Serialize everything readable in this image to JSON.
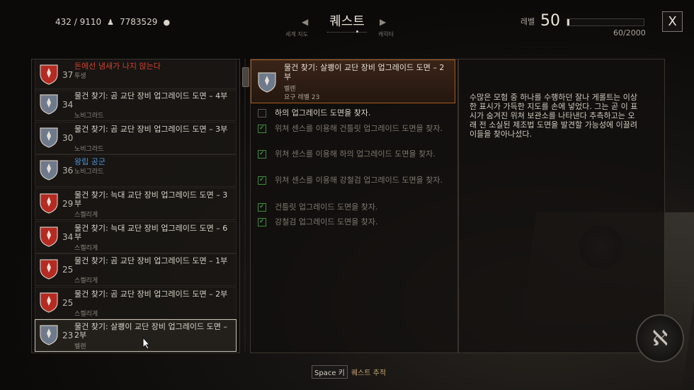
{
  "top": {
    "inventory": "432 / 9110",
    "gold": "7783529",
    "nav_title": "퀘스트",
    "nav_prev": "세계 지도",
    "nav_next": "캐릭터",
    "level_label": "레벨",
    "level_value": "50",
    "xp_text": "60/2000",
    "xp_fraction": 0.03,
    "close_label": "X"
  },
  "quests": [
    {
      "level": "37",
      "name": "돈에선 냄새가 나지 않는다",
      "giver": "투생",
      "shield": "red",
      "name_color": "red"
    },
    {
      "level": "34",
      "name": "물건 찾기: 곰 교단 장비 업그레이드 도면 – 4부",
      "giver": "노비그라드",
      "shield": "blue",
      "name_color": "normal"
    },
    {
      "level": "30",
      "name": "물건 찾기: 곰 교단 장비 업그레이드 도면 – 3부",
      "giver": "노비그라드",
      "shield": "blue",
      "name_color": "normal"
    },
    {
      "level": "36",
      "name": "왕립 공군",
      "giver": "노비그라드",
      "shield": "blue",
      "name_color": "blue"
    },
    {
      "level": "29",
      "name": "물건 찾기: 늑대 교단 장비 업그레이드 도면 – 3부",
      "giver": "스켈리게",
      "shield": "red",
      "name_color": "normal"
    },
    {
      "level": "34",
      "name": "물건 찾기: 늑대 교단 장비 업그레이드 도면 – 6부",
      "giver": "스켈리게",
      "shield": "red",
      "name_color": "normal"
    },
    {
      "level": "25",
      "name": "물건 찾기: 곰 교단 장비 업그레이드 도면 – 1부",
      "giver": "스켈리게",
      "shield": "red",
      "name_color": "normal"
    },
    {
      "level": "25",
      "name": "물건 찾기: 곰 교단 장비 업그레이드 도면 – 2부",
      "giver": "스켈리게",
      "shield": "red",
      "name_color": "normal"
    },
    {
      "level": "23",
      "name": "물건 찾기: 살쾡이 교단 장비 업그레이드 도면 – 2부",
      "giver": "벨렌",
      "shield": "blue",
      "name_color": "normal"
    }
  ],
  "selected": {
    "title": "물건 찾기: 살쾡이 교단 장비 업그레이드 도면 – 2부",
    "giver": "벨렌",
    "requirement": "요구 레벨 23"
  },
  "objectives": [
    {
      "text": "하의 업그레이드 도면을 찾자.",
      "done": false
    },
    {
      "text": "위쳐 센스를 이용해 건틀릿 업그레이드 도면을 찾자.",
      "done": true
    },
    {
      "text": "위쳐 센스를 이용해 하의 업그레이드 도면을 찾자.",
      "done": true
    },
    {
      "text": "위쳐 센스를 이용해 강철검 업그레이드 도면을 찾자.",
      "done": true
    },
    {
      "text": "건틀릿 업그레이드 도면을 찾자.",
      "done": true
    },
    {
      "text": "강철검 업그레이드 도면을 찾자.",
      "done": true
    }
  ],
  "description": "수많은 모험 중 하나를 수행하던 잘나 게롤트는 이상한 표시가 가득한 지도를 손에 넣었다. 그는 곧 이 표시가 숨겨진 위쳐 보관소를 나타낸다 추측하고는 오래 전 소실된 제조법 도면을 발견할 가능성에 이끌려 이들을 찾아나섰다.",
  "hint": {
    "key": "Space 키",
    "label": "퀘스트 추적"
  },
  "colors": {
    "accent_orange": "#a85a1e",
    "quest_red": "#d0412e",
    "quest_blue": "#4f91d1",
    "done_green": "#5fc052"
  }
}
